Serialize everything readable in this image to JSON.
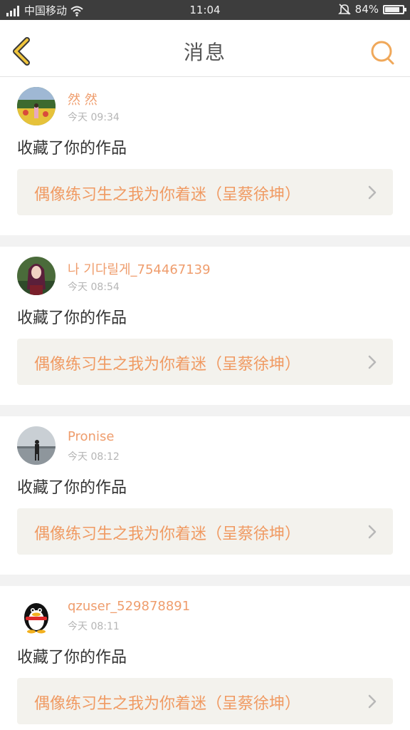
{
  "status_bar": {
    "carrier": "中国移动",
    "time": "11:04",
    "battery_percent_text": "84%",
    "battery_level": 0.84,
    "icons": [
      "signal-icon",
      "wifi-icon",
      "mute-icon",
      "battery-icon"
    ]
  },
  "header": {
    "title": "消息",
    "back_icon": "chevron-left-icon",
    "search_icon": "search-icon",
    "accent_color": "#f0a85a"
  },
  "messages": [
    {
      "username": "然 然",
      "time": "今天 09:34",
      "action": "收藏了你的作品",
      "work_title": "偶像练习生之我为你着迷（呈蔡徐坤）"
    },
    {
      "username": "나 기다릴게_754467139",
      "time": "今天 08:54",
      "action": "收藏了你的作品",
      "work_title": "偶像练习生之我为你着迷（呈蔡徐坤）"
    },
    {
      "username": "Pronise",
      "time": "今天 08:12",
      "action": "收藏了你的作品",
      "work_title": "偶像练习生之我为你着迷（呈蔡徐坤）"
    },
    {
      "username": "qzuser_529878891",
      "time": "今天 08:11",
      "action": "收藏了你的作品",
      "work_title": "偶像练习生之我为你着迷（呈蔡徐坤）"
    }
  ],
  "colors": {
    "username": "#ef9d6d",
    "work_title": "#f09a62",
    "link_background": "#f3f2ed",
    "page_background": "#f2f2f2"
  }
}
